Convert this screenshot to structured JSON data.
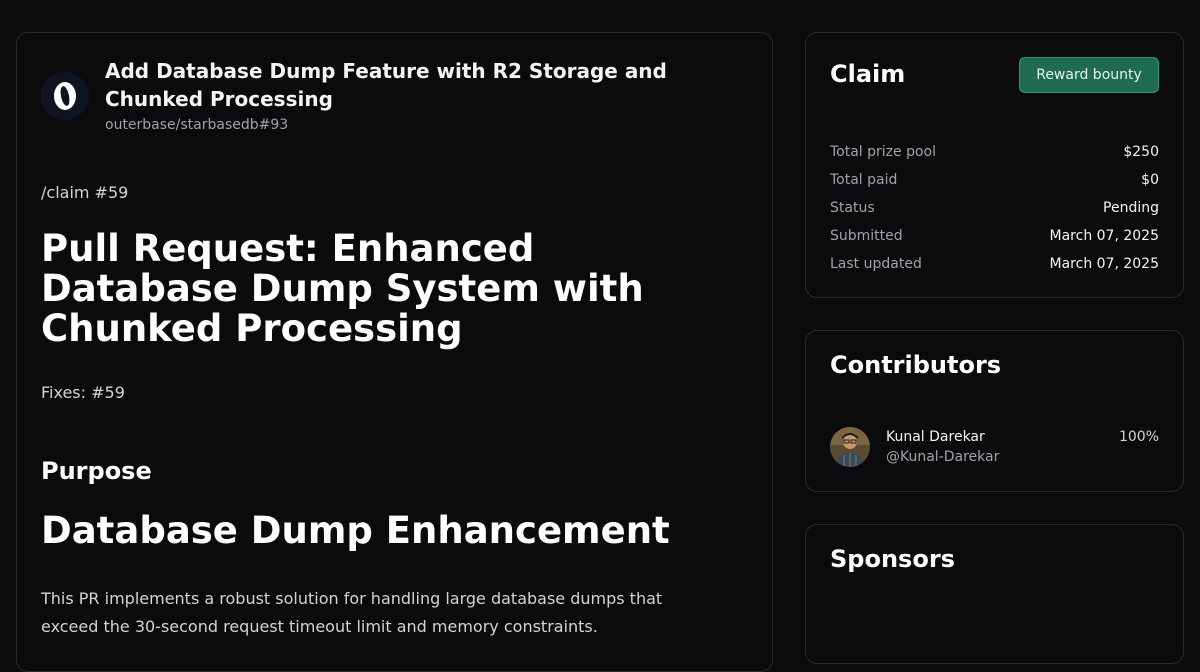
{
  "issue": {
    "title": "Add Database Dump Feature with R2 Storage and Chunked Processing",
    "repo": "outerbase/starbasedb#93"
  },
  "body": {
    "claim_ref": "/claim #59",
    "heading": "Pull Request: Enhanced Database Dump System with Chunked Processing",
    "fixes": "Fixes: #59",
    "purpose": "Purpose",
    "subheading": "Database Dump Enhancement",
    "paragraph": "This PR implements a robust solution for handling large database dumps that exceed the 30-second request timeout limit and memory constraints."
  },
  "claim": {
    "title": "Claim",
    "reward_button": "Reward bounty",
    "rows": [
      {
        "label": "Total prize pool",
        "value": "$250"
      },
      {
        "label": "Total paid",
        "value": "$0"
      },
      {
        "label": "Status",
        "value": "Pending"
      },
      {
        "label": "Submitted",
        "value": "March 07, 2025"
      },
      {
        "label": "Last updated",
        "value": "March 07, 2025"
      }
    ]
  },
  "contributors": {
    "title": "Contributors",
    "people": [
      {
        "name": "Kunal Darekar",
        "handle": "@Kunal-Darekar",
        "share": "100%"
      }
    ]
  },
  "sponsors": {
    "title": "Sponsors"
  },
  "colors": {
    "background": "#0b0b0d",
    "border": "#2a2a2e",
    "accent": "#1e6b4f"
  },
  "icons": {
    "repo_logo": "outerbase-logo-icon",
    "avatar": "user-avatar-icon"
  }
}
